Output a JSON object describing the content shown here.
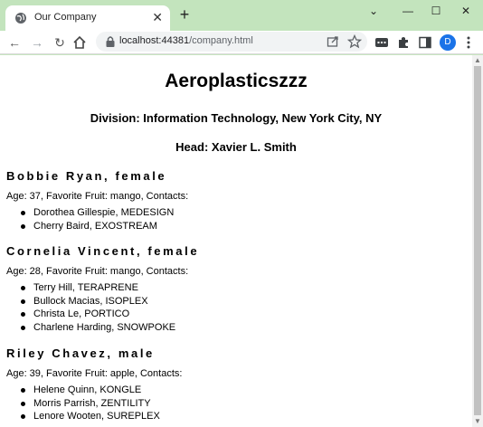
{
  "browser": {
    "tab_title": "Our Company",
    "url_host": "localhost:44381",
    "url_path": "/company.html",
    "profile_initial": "D"
  },
  "page": {
    "company": "Aeroplasticszzz",
    "division": "Division: Information Technology, New York City, NY",
    "head": "Head: Xavier L. Smith",
    "people": [
      {
        "heading": "Bobbie Ryan, female",
        "info": "Age: 37, Favorite Fruit: mango, Contacts:",
        "contacts": [
          "Dorothea Gillespie, MEDESIGN",
          "Cherry Baird, EXOSTREAM"
        ]
      },
      {
        "heading": "Cornelia Vincent, female",
        "info": "Age: 28, Favorite Fruit: mango, Contacts:",
        "contacts": [
          "Terry Hill, TERAPRENE",
          "Bullock Macias, ISOPLEX",
          "Christa Le, PORTICO",
          "Charlene Harding, SNOWPOKE"
        ]
      },
      {
        "heading": "Riley Chavez, male",
        "info": "Age: 39, Favorite Fruit: apple, Contacts:",
        "contacts": [
          "Helene Quinn, KONGLE",
          "Morris Parrish, ZENTILITY",
          "Lenore Wooten, SUREPLEX"
        ]
      }
    ]
  }
}
